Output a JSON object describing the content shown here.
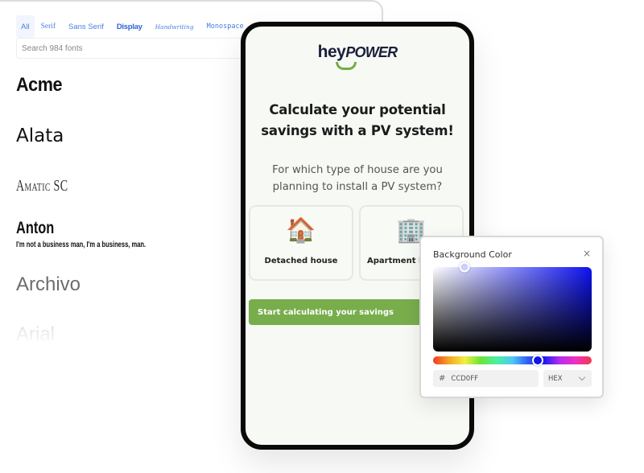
{
  "font_panel": {
    "tabs": [
      {
        "label": "All",
        "active": true
      },
      {
        "label": "Serif",
        "active": false
      },
      {
        "label": "Sans Serif",
        "active": false
      },
      {
        "label": "Display",
        "active": false
      },
      {
        "label": "Handwriting",
        "active": false
      },
      {
        "label": "Monospace",
        "active": false
      }
    ],
    "search_placeholder": "Search 984 fonts",
    "fonts": [
      {
        "name": "Acme"
      },
      {
        "name": "Alata"
      },
      {
        "name": "Amatic SC"
      },
      {
        "name": "Anton",
        "sample": "I'm not a business man, I'm a business, man."
      },
      {
        "name": "Archivo"
      },
      {
        "name": "Arial"
      }
    ]
  },
  "phone": {
    "logo": {
      "part1": "hey",
      "part2": "POWER"
    },
    "headline_line1": "Calculate your potential",
    "headline_line2": "savings with a PV system!",
    "question_line1": "For which type of house are you",
    "question_line2": "planning to install a PV system?",
    "options": [
      {
        "icon": "🏠",
        "icon_name": "house-icon",
        "label": "Detached house"
      },
      {
        "icon": "🏢",
        "icon_name": "office-building-icon",
        "label": "Apartment building"
      }
    ],
    "cta_label": "Start calculating your savings",
    "colors": {
      "brand_green": "#78ad4c",
      "brand_navy": "#1a1f3c",
      "background": "#f7f9f4"
    }
  },
  "color_picker": {
    "title": "Background Color",
    "close_glyph": "×",
    "hex_prefix": "#",
    "hex_value": "CCD0FF",
    "format": "HEX",
    "hue_fraction": 0.66,
    "saturation_fraction": 0.2,
    "value_fraction": 1.0,
    "hue_color": "#0d12f2",
    "selected_color": "#ccd0ff"
  }
}
